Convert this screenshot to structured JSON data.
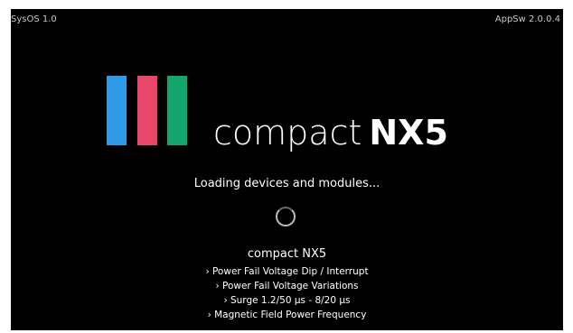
{
  "system": {
    "sysos_version": "SysOS 1.0",
    "appsw_version": "AppSw 2.0.0.4"
  },
  "logo": {
    "brand": "compact",
    "model": "NX5",
    "bar_colors": [
      "#2f9be6",
      "#e8466a",
      "#12a66c"
    ]
  },
  "status": {
    "loading_text": "Loading devices and modules...",
    "spinner_icon": "loading-spinner-icon"
  },
  "product": {
    "name": "compact NX5",
    "tests": [
      "› Power Fail Voltage Dip / Interrupt",
      "› Power Fail Voltage Variations",
      "› Surge 1.2/50 µs - 8/20 µs",
      "› Magnetic Field Power Frequency"
    ]
  }
}
